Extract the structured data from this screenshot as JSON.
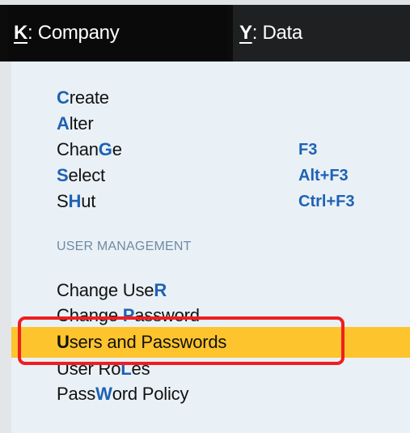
{
  "menubar": {
    "company": {
      "key": "K",
      "rest": ": Company"
    },
    "data": {
      "key": "Y",
      "rest": ": Data"
    }
  },
  "company_menu": {
    "create": {
      "hot": "C",
      "rest": "reate"
    },
    "alter": {
      "hot": "A",
      "rest": "lter"
    },
    "change": {
      "pre": "Chan",
      "hot": "G",
      "post": "e",
      "shortcut": "F3"
    },
    "select": {
      "hot": "S",
      "rest": "elect",
      "shortcut": "Alt+F3"
    },
    "shut": {
      "pre": "S",
      "hot": "H",
      "post": "ut",
      "shortcut": "Ctrl+F3"
    },
    "section_label": "USER MANAGEMENT",
    "change_user": {
      "pre": "Change Use",
      "hot": "R"
    },
    "change_password": {
      "pre": "Change ",
      "hot": "P",
      "post": "assword"
    },
    "users_passwords": {
      "hot": "U",
      "rest": "sers and Passwords"
    },
    "user_roles": {
      "pre": "User Ro",
      "hot": "L",
      "post": "es"
    },
    "password_policy": {
      "pre": "Pass",
      "hot": "W",
      "post": "ord Policy"
    }
  },
  "colors": {
    "menubar_bg": "#0c0c0c",
    "panel_bg": "#e9f1f6",
    "hotkey": "#1f61b5",
    "highlight": "#fdc42e",
    "annotation": "#ef1e21"
  }
}
